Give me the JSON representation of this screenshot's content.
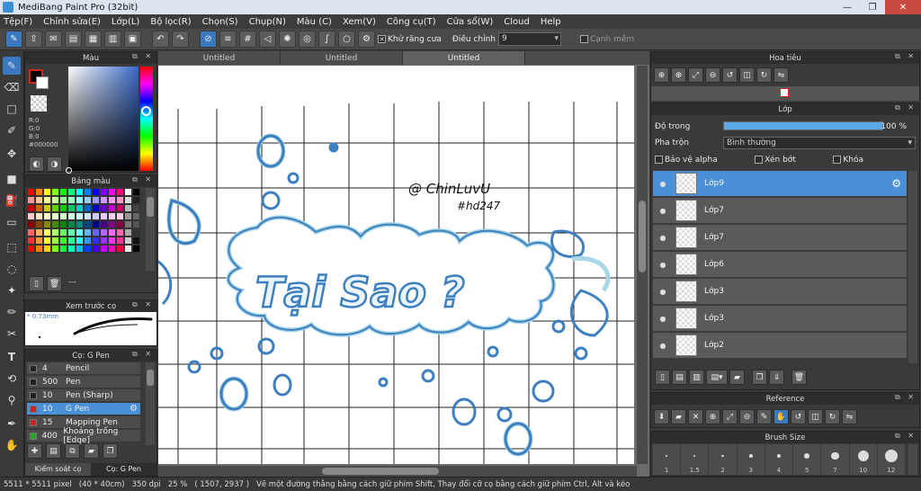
{
  "window": {
    "title": "MediBang Paint Pro (32bit)"
  },
  "menu": [
    "Tệp(F)",
    "Chỉnh sửa(E)",
    "Lớp(L)",
    "Bộ lọc(R)",
    "Chọn(S)",
    "Chụp(N)",
    "Màu (C)",
    "Xem(V)",
    "Công cụ(T)",
    "Cửa sổ(W)",
    "Cloud",
    "Help"
  ],
  "toolbar": {
    "antialias_label": "Khử răng cưa",
    "antialias_checked": true,
    "adjust_label": "Điều chỉnh",
    "adjust_value": "9",
    "edge_label": "Cạnh mềm",
    "edge_checked": false
  },
  "color_panel": {
    "title": "Màu",
    "rgb": {
      "r": "R:0",
      "g": "G:0",
      "b": "B:0"
    },
    "hex": "#000000",
    "primary": "#000000",
    "secondary": "#ffffff"
  },
  "swatch_panel": {
    "title": "Bảng màu",
    "extra": "---"
  },
  "preview_panel": {
    "title": "Xem trước cọ",
    "size": "0.73mm"
  },
  "brush_panel": {
    "title": "Cọ: G Pen",
    "brushes": [
      {
        "size": "4",
        "name": "Pencil",
        "color": "#222222"
      },
      {
        "size": "500",
        "name": "Pen",
        "color": "#222222"
      },
      {
        "size": "10",
        "name": "Pen (Sharp)",
        "color": "#222222"
      },
      {
        "size": "10",
        "name": "G Pen",
        "color": "#cc2222",
        "selected": true
      },
      {
        "size": "15",
        "name": "Mapping Pen",
        "color": "#cc2222"
      },
      {
        "size": "400",
        "name": "Khoảng trống [Edge]",
        "color": "#22aa22"
      }
    ],
    "tab1": "Kiểm soát cọ",
    "tab2": "Cọ: G Pen"
  },
  "tabs": [
    "Untitled",
    "Untitled",
    "Untitled"
  ],
  "navigator_panel": {
    "title": "Hoa tiêu"
  },
  "layer_panel": {
    "title": "Lớp",
    "opacity_label": "Độ trong",
    "opacity_value": "100 %",
    "opacity": 1.0,
    "blend_label": "Pha trộn",
    "blend_value": "Bình thường",
    "protect_alpha": "Bảo vệ alpha",
    "clipping": "Xén bớt",
    "lock": "Khóa",
    "layers": [
      {
        "name": "Lớp9",
        "selected": true
      },
      {
        "name": "Lớp7"
      },
      {
        "name": "Lớp7"
      },
      {
        "name": "Lớp6"
      },
      {
        "name": "Lớp3"
      },
      {
        "name": "Lớp3"
      },
      {
        "name": "Lớp2"
      }
    ]
  },
  "reference_panel": {
    "title": "Reference"
  },
  "brushsize_panel": {
    "title": "Brush Size",
    "sizes": [
      "1",
      "1.5",
      "2",
      "3",
      "4",
      "5",
      "7",
      "10",
      "12"
    ]
  },
  "artwork": {
    "main_text": "Tại Sao ?",
    "signature": "@ ChinLuvU",
    "tag": "#hd247",
    "stroke_color": "#3d7fbf",
    "light_color": "#a9d7e8"
  },
  "status": {
    "dimensions": "5511 * 5511 pixel",
    "size_cm": "(40 * 40cm)",
    "dpi": "350 dpi",
    "zoom": "25 %",
    "coords": "( 1507, 2937 )",
    "hint": "Vẽ một đường thẳng bằng cách giữ phím Shift, Thay đổi cỡ cọ bằng cách giữ phím Ctrl, Alt và kéo"
  }
}
